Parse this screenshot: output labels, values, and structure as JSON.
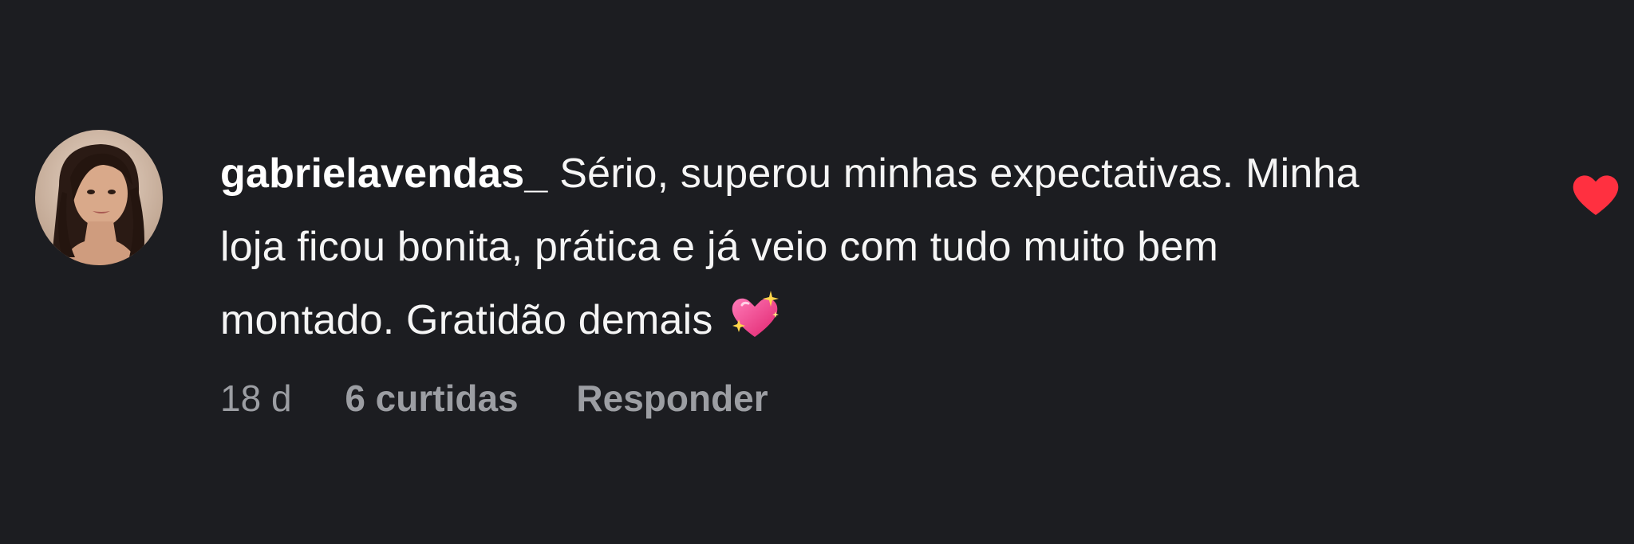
{
  "comment": {
    "username": "gabrielavendas_",
    "text_line1": " Sério, superou minhas expectativas. Minha",
    "text_line2": "loja ficou bonita, prática e já veio com tudo muito bem",
    "text_line3": "montado. Gratidão demais",
    "emoji": "sparkling-heart-icon",
    "timestamp": "18 d",
    "likes": "6 curtidas",
    "reply_label": "Responder",
    "liked": true
  },
  "colors": {
    "background": "#1c1d21",
    "text": "#f5f5f5",
    "meta": "#9c9ea3",
    "like_heart": "#ff3040"
  }
}
